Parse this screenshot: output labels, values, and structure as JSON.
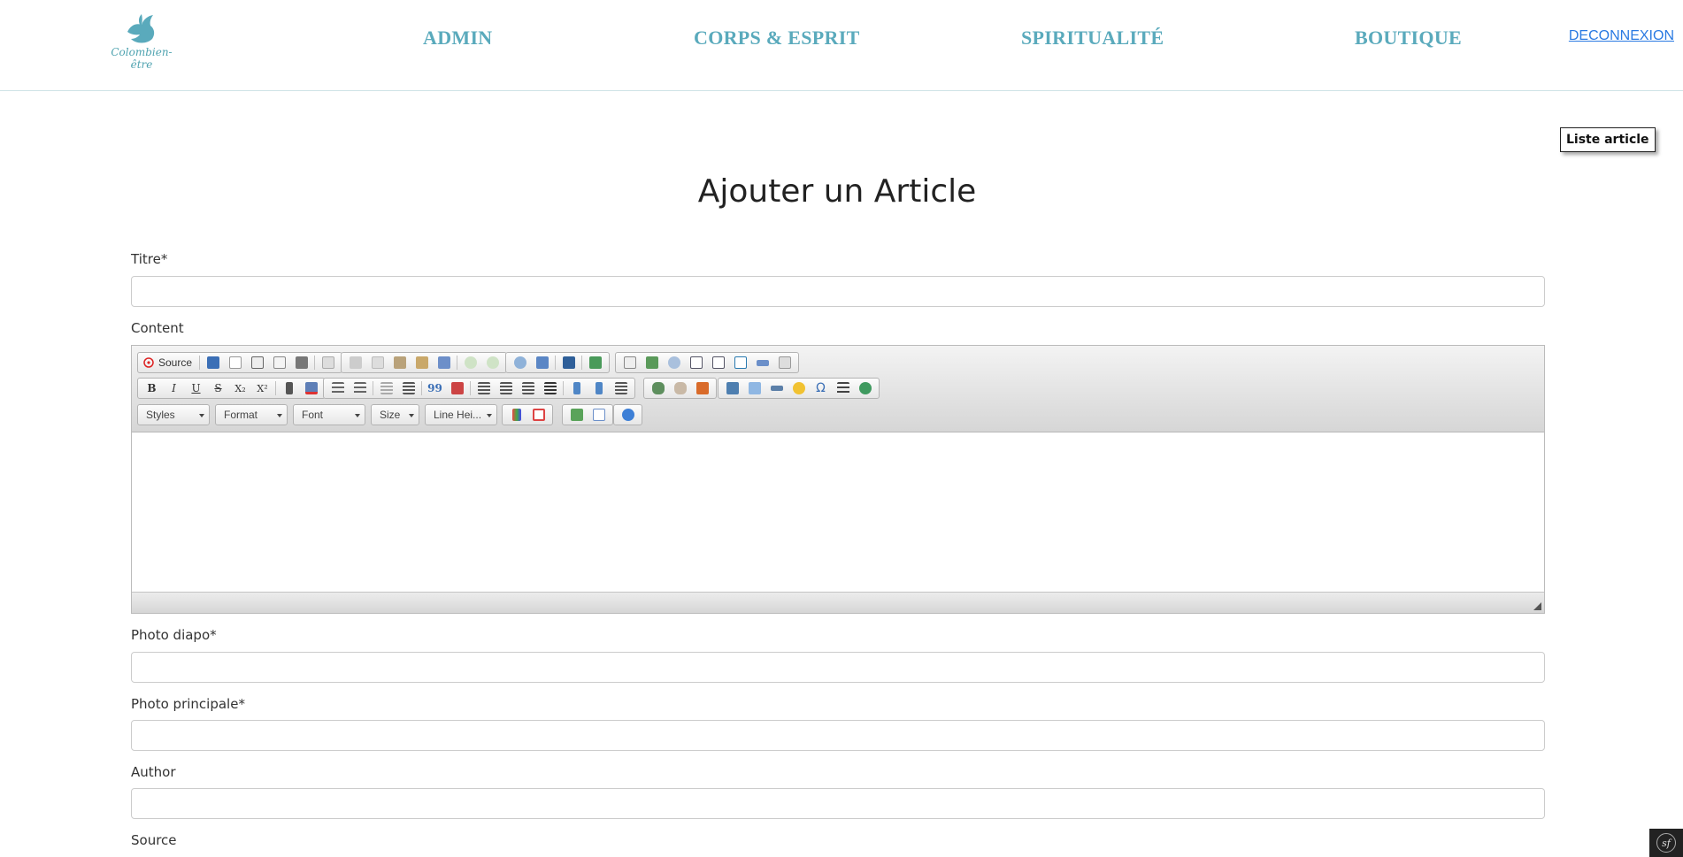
{
  "header": {
    "logo_text": "Colombien-être",
    "nav": [
      "ADMIN",
      "CORPS & ESPRIT",
      "SPIRITUALITÉ",
      "BOUTIQUE"
    ],
    "logout_label": "DECONNEXION"
  },
  "list_button_label": "Liste article",
  "page_title": "Ajouter un Article",
  "form": {
    "titre_label": "Titre*",
    "titre_value": "",
    "content_label": "Content",
    "photo_diapo_label": "Photo diapo*",
    "photo_diapo_value": "",
    "photo_principale_label": "Photo principale*",
    "photo_principale_value": "",
    "author_label": "Author",
    "author_value": "",
    "source_label": "Source"
  },
  "editor": {
    "source_label": "Source",
    "bold": "B",
    "italic": "I",
    "underline": "U",
    "strike": "S",
    "subscript": "X₂",
    "superscript": "X²",
    "quote": "99",
    "omega": "Ω",
    "dropdowns": [
      "Styles",
      "Format",
      "Font",
      "Size",
      "Line Hei..."
    ]
  },
  "colors": {
    "brand": "#5aaabc",
    "link": "#2a7ae2"
  }
}
